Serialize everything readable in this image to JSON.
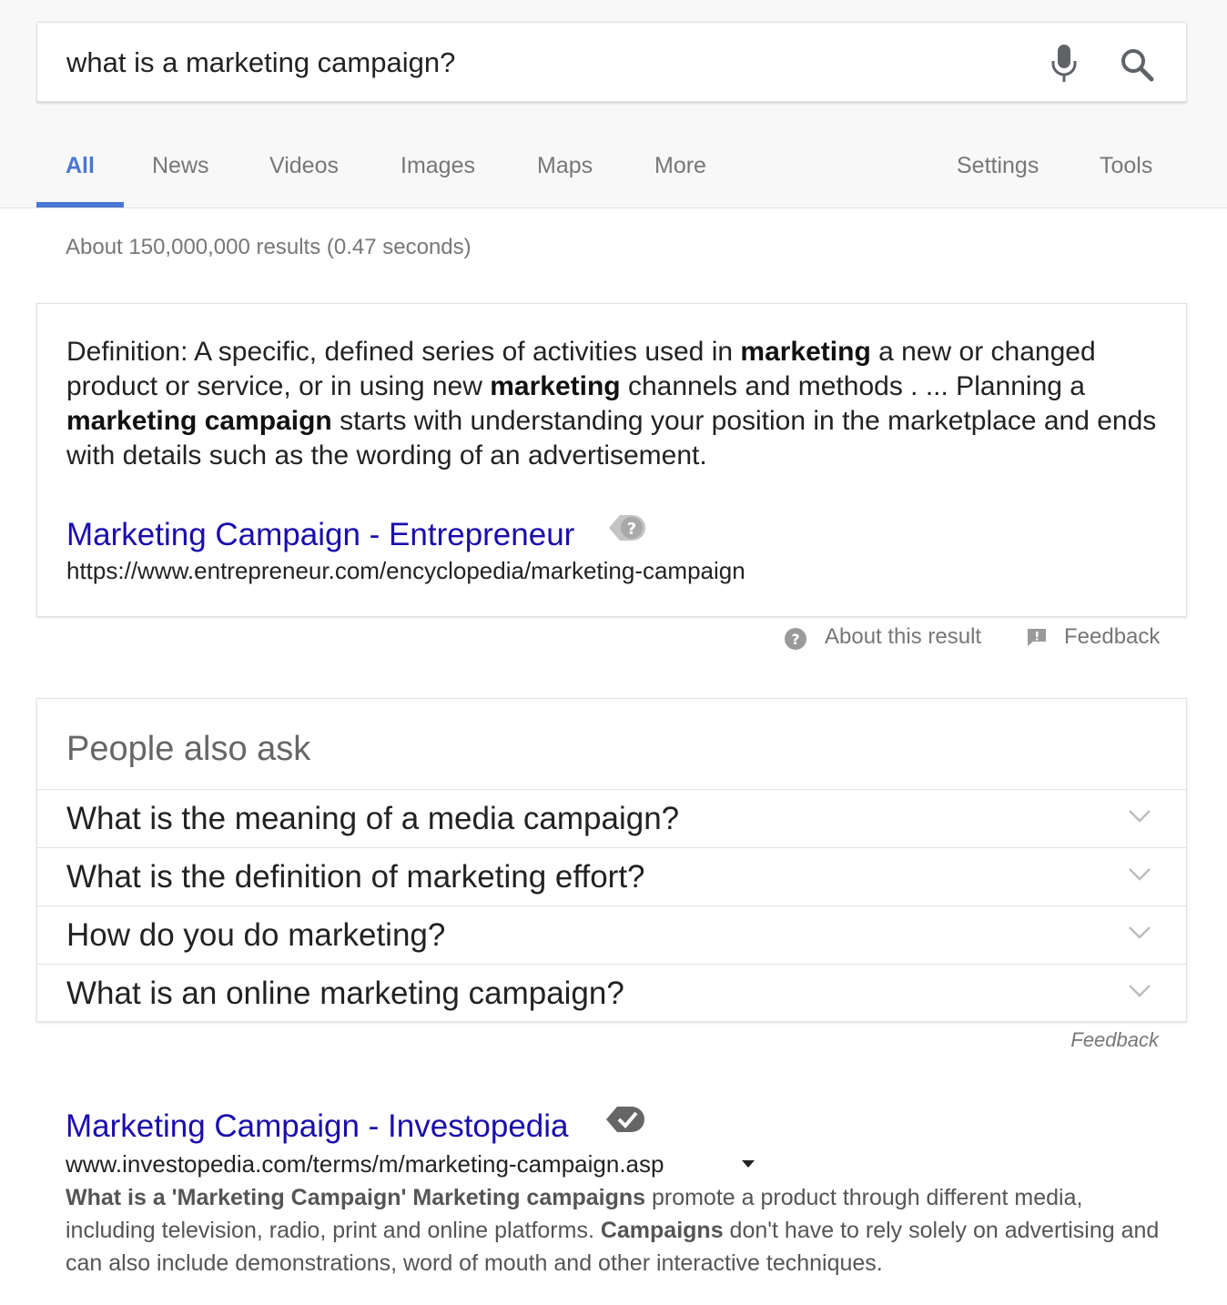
{
  "search": {
    "query": "what is a marketing campaign?"
  },
  "tabs": {
    "items": [
      "All",
      "News",
      "Videos",
      "Images",
      "Maps",
      "More"
    ],
    "settings": "Settings",
    "tools": "Tools"
  },
  "stats": "About 150,000,000 results (0.47 seconds)",
  "featured": {
    "segments": [
      {
        "text": "Definition: A specific, defined series of activities used in ",
        "bold": false
      },
      {
        "text": "marketing",
        "bold": true
      },
      {
        "text": " a new or changed product or service, or in using new ",
        "bold": false
      },
      {
        "text": "marketing",
        "bold": true
      },
      {
        "text": " channels and methods . ... Planning a ",
        "bold": false
      },
      {
        "text": "marketing campaign",
        "bold": true
      },
      {
        "text": " starts with understanding your position in the marketplace and ends with details such as the wording of an advertisement.",
        "bold": false
      }
    ],
    "title": "Marketing Campaign - Entrepreneur",
    "url": "https://www.entrepreneur.com/encyclopedia/marketing-campaign",
    "about_label": "About this result",
    "feedback_label": "Feedback"
  },
  "paa": {
    "title": "People also ask",
    "questions": [
      "What is the meaning of a media campaign?",
      "What is the definition of marketing effort?",
      "How do you do marketing?",
      "What is an online marketing campaign?"
    ],
    "feedback_label": "Feedback"
  },
  "result": {
    "title": "Marketing Campaign - Investopedia",
    "url": "www.investopedia.com/terms/m/marketing-campaign.asp",
    "snippet": [
      {
        "text": "What is a 'Marketing Campaign' Marketing campaigns",
        "bold": true
      },
      {
        "text": " promote a product through different media, including television, radio, print and online platforms. ",
        "bold": false
      },
      {
        "text": "Campaigns",
        "bold": true
      },
      {
        "text": " don't have to rely solely on advertising and can also include demonstrations, word of mouth and other interactive techniques.",
        "bold": false
      }
    ]
  },
  "colors": {
    "link": "#1a0dab",
    "tab_active": "#4a76d4",
    "muted": "#777777"
  }
}
